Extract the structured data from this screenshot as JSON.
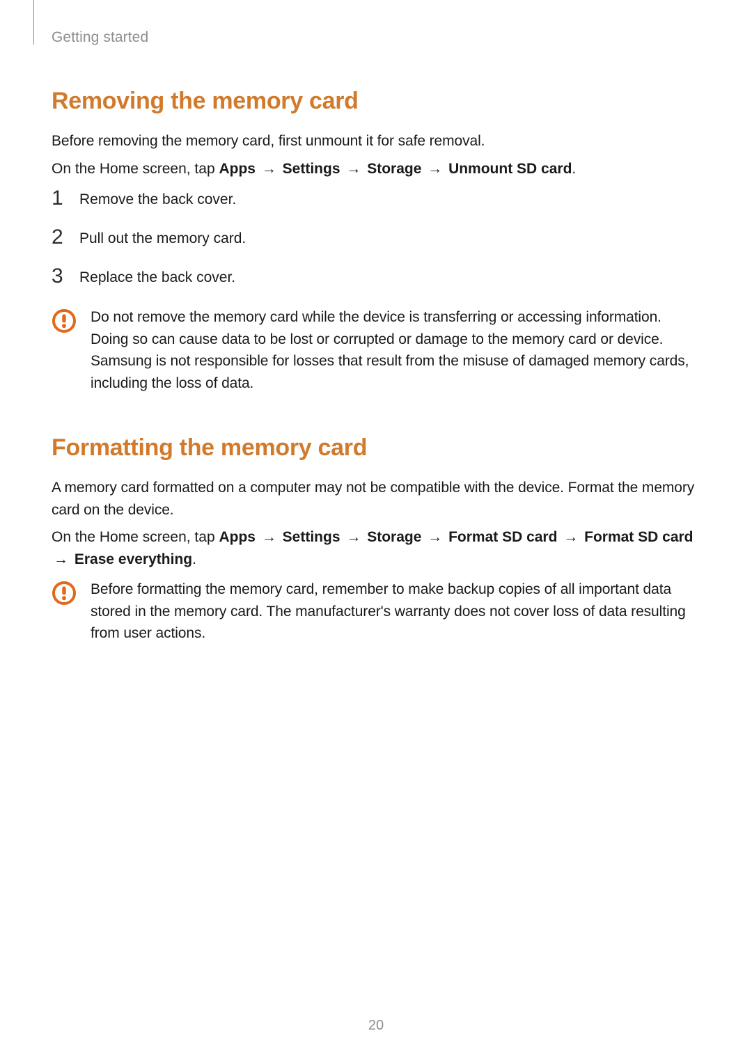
{
  "running_head": "Getting started",
  "page_number": "20",
  "arrow": "→",
  "section1": {
    "title": "Removing the memory card",
    "intro": "Before removing the memory card, first unmount it for safe removal.",
    "nav_prefix": "On the Home screen, tap ",
    "nav_items": [
      "Apps",
      "Settings",
      "Storage",
      "Unmount SD card"
    ],
    "nav_suffix": ".",
    "steps": [
      "Remove the back cover.",
      "Pull out the memory card.",
      "Replace the back cover."
    ],
    "caution": "Do not remove the memory card while the device is transferring or accessing information. Doing so can cause data to be lost or corrupted or damage to the memory card or device. Samsung is not responsible for losses that result from the misuse of damaged memory cards, including the loss of data."
  },
  "section2": {
    "title": "Formatting the memory card",
    "intro": "A memory card formatted on a computer may not be compatible with the device. Format the memory card on the device.",
    "nav_prefix": "On the Home screen, tap ",
    "nav_items": [
      "Apps",
      "Settings",
      "Storage",
      "Format SD card",
      "Format SD card",
      "Erase everything"
    ],
    "nav_suffix": ".",
    "caution": "Before formatting the memory card, remember to make backup copies of all important data stored in the memory card. The manufacturer's warranty does not cover loss of data resulting from user actions."
  }
}
